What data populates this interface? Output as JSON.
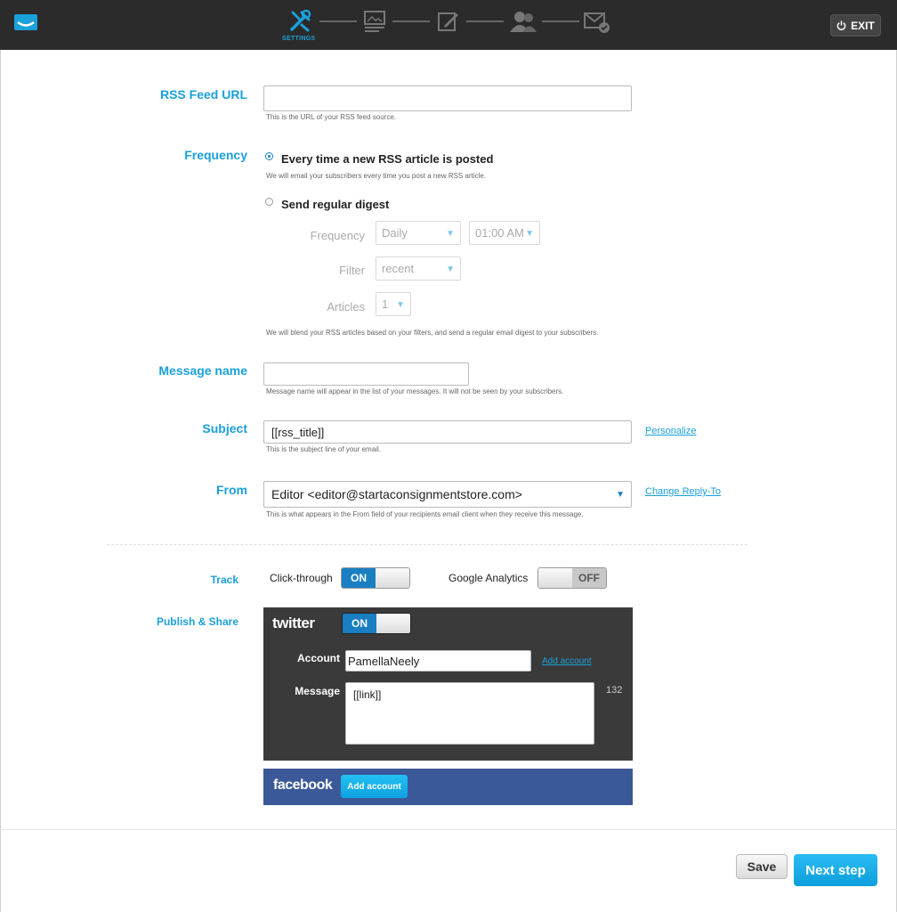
{
  "header": {
    "steps": [
      {
        "name": "settings",
        "label": "SETTINGS",
        "active": true
      },
      {
        "name": "design",
        "label": ""
      },
      {
        "name": "edit",
        "label": ""
      },
      {
        "name": "recipients",
        "label": ""
      },
      {
        "name": "send",
        "label": ""
      }
    ],
    "exit_label": "EXIT"
  },
  "form": {
    "rss_feed_url": {
      "label": "RSS Feed URL",
      "value": "",
      "help": "This is the URL of your RSS feed source."
    },
    "frequency": {
      "label": "Frequency",
      "option_each": "Every time a new RSS article is posted",
      "option_each_help": "We will email your subscribers every time you post a new RSS article.",
      "option_digest": "Send regular digest",
      "digest": {
        "frequency_label": "Frequency",
        "frequency_value": "Daily",
        "time_value": "01:00 AM",
        "filter_label": "Filter",
        "filter_value": "recent",
        "articles_label": "Articles",
        "articles_value": "1",
        "help": "We will blend your RSS articles based on your filters, and send a regular email digest to your subscribers."
      }
    },
    "message_name": {
      "label": "Message name",
      "value": "",
      "help": "Message name will appear in the list of your messages. It will not be seen by your subscribers."
    },
    "subject": {
      "label": "Subject",
      "value": "[[rss_title]]",
      "help": "This is the subject line of your email.",
      "link": "Personalize"
    },
    "from": {
      "label": "From",
      "value": "Editor <editor@startaconsignmentstore.com>",
      "help": "This is what appears in the From field of your recipients email client when they receive this message.",
      "link": "Change Reply-To"
    },
    "track": {
      "label": "Track",
      "click_label": "Click-through",
      "click_state": "ON",
      "ga_label": "Google Analytics",
      "ga_state": "OFF"
    },
    "publish": {
      "label": "Publish & Share",
      "twitter": {
        "brand": "twitter",
        "state": "ON",
        "account_label": "Account",
        "account_value": "PamellaNeely",
        "add_account": "Add account",
        "message_label": "Message",
        "message_value": "[[link]]",
        "char_count": "132"
      },
      "facebook": {
        "brand": "facebook",
        "add_account": "Add account"
      }
    }
  },
  "footer": {
    "save": "Save",
    "next": "Next step"
  },
  "colors": {
    "accent": "#1aa0db",
    "topbar": "#2b2b2b",
    "toggle_on": "#1a7fc2",
    "facebook": "#3b5998",
    "twitter_panel": "#3a3a3a"
  }
}
